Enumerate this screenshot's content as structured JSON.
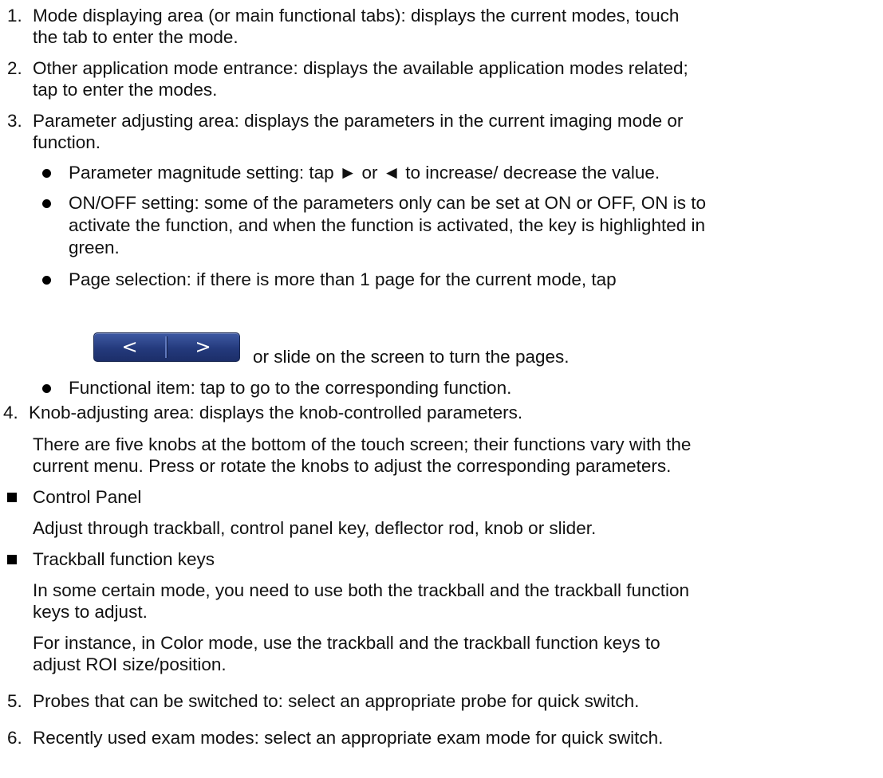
{
  "list_1": [
    {
      "number": "1.",
      "line1": "Mode displaying area (or main functional tabs): displays the current modes, touch",
      "line2": "the tab to enter the mode."
    },
    {
      "number": "2.",
      "line1": "Other application mode entrance: displays the available application modes related;",
      "line2": "tap to enter the modes."
    },
    {
      "number": "3.",
      "line1": "Parameter adjusting area: displays the parameters in the current imaging mode or",
      "line2": "function."
    }
  ],
  "bullets": {
    "magnitude": "Parameter magnitude setting: tap ► or ◄ to increase/ decrease the value.",
    "onoff_1": "ON/OFF setting: some of the parameters only can be set at ON or OFF, ON is to",
    "onoff_2": "activate the function, and when the function is activated, the key is highlighted in",
    "onoff_3": "green.",
    "page_1": "Page selection: if there is more than 1 page for the current mode, tap",
    "page_2": "or slide on the screen to turn the pages.",
    "functional": "Functional item: tap to go to the corresponding function."
  },
  "page_button": {
    "prev": "<",
    "next": ">"
  },
  "item_4": {
    "number": "4.",
    "text": "Knob-adjusting area: displays the knob-controlled parameters.",
    "para_1": "There are five knobs at the bottom of the touch screen; their functions vary with the",
    "para_2": "current menu. Press or rotate the knobs to adjust the corresponding parameters."
  },
  "control_panel": {
    "heading": "Control Panel",
    "text": "Adjust through trackball, control panel key, deflector rod, knob or slider."
  },
  "trackball_keys": {
    "heading": "Trackball function keys",
    "para1_1": "In some certain mode, you need to use both the trackball and the trackball function",
    "para1_2": "keys to adjust.",
    "para2_1": "For instance, in Color mode, use the trackball and the trackball function keys to",
    "para2_2": "adjust ROI size/position."
  },
  "list_2": [
    {
      "number": "5.",
      "text": "Probes that can be switched to: select an appropriate probe for quick switch."
    },
    {
      "number": "6.",
      "text": "Recently used exam modes: select an appropriate exam mode for quick switch."
    }
  ]
}
